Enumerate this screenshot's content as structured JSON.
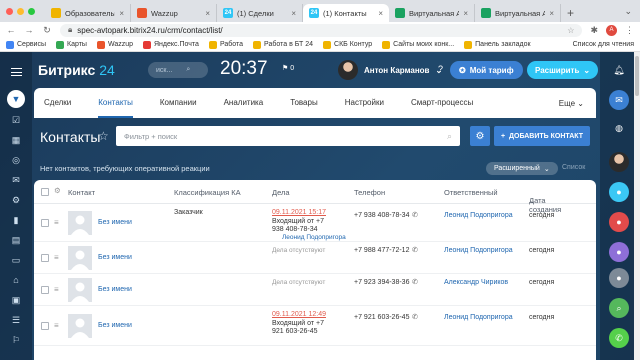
{
  "browser": {
    "tabs": [
      {
        "title": "Образовательная",
        "fav": "#f0b400",
        "glyph": "",
        "active": false
      },
      {
        "title": "Wazzup",
        "fav": "#e9542b",
        "glyph": "",
        "active": false
      },
      {
        "title": "(1) Сделки",
        "fav": "#2fc6f6",
        "glyph": "24",
        "active": false
      },
      {
        "title": "(1) Контакты",
        "fav": "#2fc6f6",
        "glyph": "24",
        "active": true
      },
      {
        "title": "Виртуальная АТС",
        "fav": "#1aa260",
        "glyph": "",
        "active": false
      },
      {
        "title": "Виртуальная АТС",
        "fav": "#1aa260",
        "glyph": "",
        "active": false
      }
    ],
    "url": "spec-avtopark.bitrix24.ru/crm/contact/list/",
    "bookmarks": [
      "Сервисы",
      "Карты",
      "Wazzup",
      "Яндекс.Почта",
      "Работа",
      "Работа в БТ 24",
      "СКБ Контур",
      "Сайты моих конк...",
      "Панель закладок"
    ],
    "reading_list": "Список для чтения",
    "profile_letter": "A"
  },
  "header": {
    "logo": "Битрикс",
    "logo_num": "24",
    "search_placeholder": "иск...",
    "time": "20:37",
    "flag_count": "0",
    "user_name": "Антон Карманов",
    "tariff_label": "Мой тариф",
    "expand_label": "Расширить"
  },
  "nav": {
    "items": [
      "Сделки",
      "Контакты",
      "Компании",
      "Аналитика",
      "Товары",
      "Настройки",
      "Смарт-процессы"
    ],
    "active": "Контакты",
    "more": "Еще"
  },
  "page": {
    "title": "Контакты",
    "filter_placeholder": "Фильтр + поиск",
    "add_button": "ДОБАВИТЬ КОНТАКТ",
    "reaction_text": "Нет контактов, требующих оперативной реакции",
    "extended_label": "Расширенный",
    "list_label": "Список"
  },
  "table": {
    "columns": [
      "Контакт",
      "Классификация КА",
      "Дела",
      "Телефон",
      "Ответственный",
      "Дата создания"
    ],
    "rows": [
      {
        "name": "Без имени",
        "classification": "Заказчик",
        "activity_date": "09.11.2021 15:17",
        "activity_lines": [
          "Входящий от +7",
          "938 408-78-34"
        ],
        "activity_who": "Леонид Подопригора",
        "phone": "+7 938 408-78-34",
        "responsible": "Леонид Подопригора",
        "created": "сегодня"
      },
      {
        "name": "Без имени",
        "classification": "",
        "activity_date": "",
        "activity_lines": [
          "Дела отсутствуют"
        ],
        "activity_who": "",
        "phone": "+7 988 477-72-12",
        "responsible": "Леонид Подопригора",
        "created": "сегодня"
      },
      {
        "name": "Без имени",
        "classification": "",
        "activity_date": "",
        "activity_lines": [
          "Дела отсутствуют"
        ],
        "activity_who": "",
        "phone": "+7 923 394-38-36",
        "responsible": "Александр Чириков",
        "created": "сегодня"
      },
      {
        "name": "Без имени",
        "classification": "",
        "activity_date": "09.11.2021 12:49",
        "activity_lines": [
          "Входящий от +7",
          "921 603-26-45"
        ],
        "activity_who": "",
        "phone": "+7 921 603-26-45",
        "responsible": "Леонид Подопригора",
        "created": "сегодня"
      }
    ]
  },
  "colors": {
    "accent": "#3b80d3",
    "cyan": "#2fc6f6",
    "link": "#2067b0",
    "overdue": "#e15b4d"
  }
}
